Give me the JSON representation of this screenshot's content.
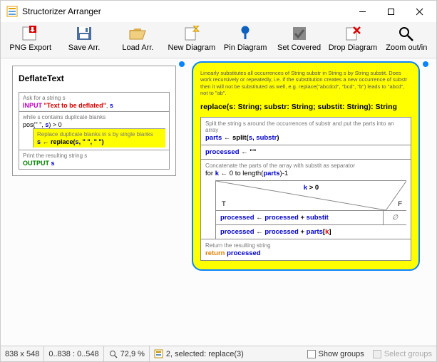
{
  "window": {
    "title": "Structorizer Arranger"
  },
  "toolbar": {
    "png_export": "PNG Export",
    "save_arr": "Save Arr.",
    "load_arr": "Load Arr.",
    "new_diagram": "New Diagram",
    "pin_diagram": "Pin Diagram",
    "set_covered": "Set Covered",
    "drop_diagram": "Drop Diagram",
    "zoom": "Zoom out/in"
  },
  "d1": {
    "title": "DeflateText",
    "c1": "Ask for a string s",
    "l1_kw": "INPUT",
    "l1_txt": "\"Text to be deflated\"",
    "l1_var": "s",
    "c2": "while s contains duplicate blanks",
    "l2": "pos(\"  \", ",
    "l2_var": "s",
    "l2_tail": ") > 0",
    "c3": "Replace duplicate blanks in s by single blanks",
    "l3_var": "s",
    "l3_mid": " ← replace(",
    "l3_var2": "s",
    "l3_a": ", \"  \", \" \")",
    "c4": "Print the resulting string s",
    "l4_kw": "OUTPUT",
    "l4_var": "s"
  },
  "d2": {
    "note": "Linearly substitutes all occurrences of String substr in String s by String substit. Does work recursively or repeatedly, i.e. if the substitution creates a new occurrence of substr then it will not be substituted as well, e.g. replace(\"abcdcd\", \"bcd\", \"b\") leads to \"abcd\", not to \"ab\".",
    "sig": "replace(s: String; substr: String; substit: String): String",
    "c1": "Split the string s around the occurrences of substr and put the parts into an array",
    "l1_lhs": "parts",
    "l1_mid": " ← split(",
    "l1_a1": "s",
    "l1_a2": "substr",
    "l2_lhs": "processed",
    "l2_rhs": " ← \"\"",
    "c3": "Concatenate the parts of the array with substit as separator",
    "for_a": "for ",
    "for_k": "k",
    "for_b": " ← 0 to length(",
    "for_parts": "parts",
    "for_c": ")-1",
    "cond_k": "k",
    "cond_tail": " > 0",
    "cond_T": "T",
    "cond_F": "F",
    "t1_lhs": "processed",
    "t1_mid": " ← ",
    "t1_r1": "processed",
    "t1_plus": " + ",
    "t1_r2": "substit",
    "empty": "∅",
    "n_lhs": "processed",
    "n_mid": " ← ",
    "n_r1": "processed",
    "n_plus": " + ",
    "n_r2": "parts",
    "n_idx1": "[",
    "n_k": "k",
    "n_idx2": "]",
    "c_ret": "Return the resulting string",
    "ret_kw": "return",
    "ret_var": "processed"
  },
  "status": {
    "dims": "838 x 548",
    "range": "0..838 : 0..548",
    "zoom": "72,9 %",
    "sel": "2, selected: replace(3)",
    "show_groups": "Show groups",
    "select_groups": "Select groups"
  },
  "chart_data": [
    {
      "type": "diagram",
      "subtype": "nassi-shneiderman",
      "name": "DeflateText",
      "steps": [
        {
          "kind": "input",
          "comment": "Ask for a string s",
          "prompt": "Text to be deflated",
          "var": "s"
        },
        {
          "kind": "while",
          "comment": "while s contains duplicate blanks",
          "condition": "pos(\"  \", s) > 0",
          "body": [
            {
              "kind": "assign",
              "comment": "Replace duplicate blanks in s by single blanks",
              "target": "s",
              "expr": "replace(s, \"  \", \" \")",
              "highlighted": true
            }
          ]
        },
        {
          "kind": "output",
          "comment": "Print the resulting string s",
          "expr": "s"
        }
      ],
      "selected": false
    },
    {
      "type": "diagram",
      "subtype": "nassi-shneiderman-function",
      "signature": "replace(s: String; substr: String; substit: String): String",
      "description": "Linearly substitutes all occurrences of String substr in String s by String substit. Does work recursively or repeatedly, i.e. if the substitution creates a new occurrence of substr then it will not be substituted as well, e.g. replace(\"abcdcd\", \"bcd\", \"b\") leads to \"abcd\", not to \"ab\".",
      "steps": [
        {
          "kind": "assign",
          "comment": "Split the string s around the occurrences of substr and put the parts into an array",
          "target": "parts",
          "expr": "split(s, substr)"
        },
        {
          "kind": "assign",
          "target": "processed",
          "expr": "\"\""
        },
        {
          "kind": "for",
          "comment": "Concatenate the parts of the array with substit as separator",
          "var": "k",
          "from": 0,
          "to": "length(parts)-1",
          "body": [
            {
              "kind": "if",
              "condition": "k > 0",
              "true": [
                {
                  "kind": "assign",
                  "target": "processed",
                  "expr": "processed + substit"
                }
              ],
              "false": []
            },
            {
              "kind": "assign",
              "target": "processed",
              "expr": "processed + parts[k]"
            }
          ]
        },
        {
          "kind": "return",
          "comment": "Return the resulting string",
          "expr": "processed"
        }
      ],
      "selected": true
    }
  ]
}
